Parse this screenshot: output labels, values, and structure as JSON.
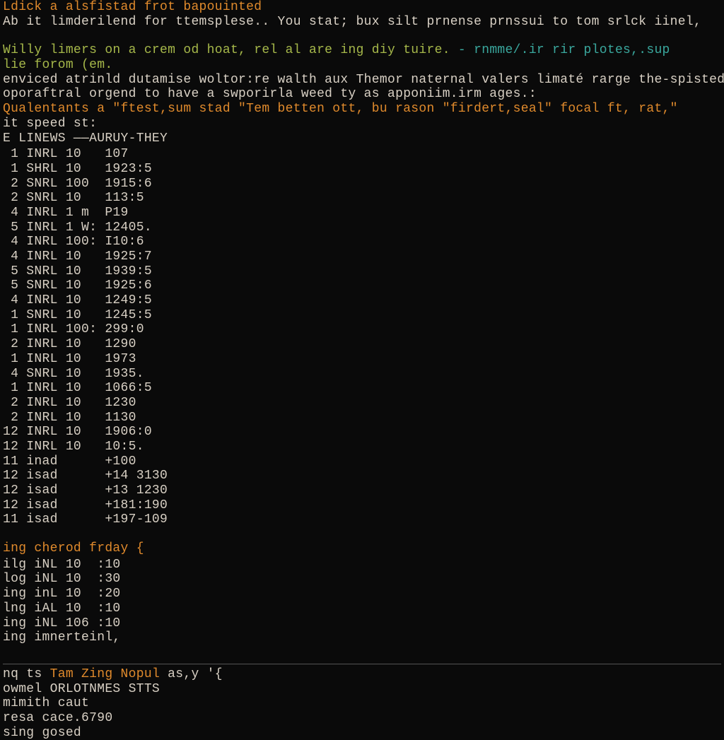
{
  "top": {
    "l1": "Ldick a alsfistad frot bapouinted",
    "l2": "Ab it limderilend for ttemsplese.. You stat; bux silt prnense prnssui to tom srlck iinel,",
    "l3_a": "Willy limers on a crem od hoat, rel al are ing diy tuire. ",
    "l3_b": "- rnmme/.ir rir plotes,.sup",
    "l4": "lie forom (em.",
    "l5": "enviced atrinld dutamise woltor:re walth aux Themor naternal valers limaté rarge the-spisted",
    "l6": "oporaftral orgend to have a swporirla weed ty as apponiim.irm ages.:",
    "l7": "Qualentants a \"ftest,sum stad \"Tem betten ott, bu rason \"firdert,seal\" focal ft, rat,\"",
    "l8": "it speed st:",
    "header": "E LINEWS ——AURUY-THEY"
  },
  "rows": [
    {
      "c1": " 1",
      "c2": "INRL",
      "c3": "10",
      "c4": "107"
    },
    {
      "c1": " 1",
      "c2": "SHRL",
      "c3": "10",
      "c4": "1923:5"
    },
    {
      "c1": " 2",
      "c2": "SNRL",
      "c3": "100",
      "c4": "1915:6"
    },
    {
      "c1": " 2",
      "c2": "SNRL",
      "c3": "10",
      "c4": "113:5"
    },
    {
      "c1": " 4",
      "c2": "INRL",
      "c3": "1 m",
      "c4": "P19"
    },
    {
      "c1": " 5",
      "c2": "INRL",
      "c3": "1 W:",
      "c4": "12405."
    },
    {
      "c1": " 4",
      "c2": "INRL",
      "c3": "100:",
      "c4": "I10:6"
    },
    {
      "c1": " 4",
      "c2": "INRL",
      "c3": "10",
      "c4": "1925:7"
    },
    {
      "c1": " 5",
      "c2": "SNRL",
      "c3": "10",
      "c4": "1939:5"
    },
    {
      "c1": " 5",
      "c2": "SNRL",
      "c3": "10",
      "c4": "1925:6"
    },
    {
      "c1": " 4",
      "c2": "INRL",
      "c3": "10",
      "c4": "1249:5"
    },
    {
      "c1": " 1",
      "c2": "SNRL",
      "c3": "10",
      "c4": "1245:5"
    },
    {
      "c1": " 1",
      "c2": "INRL",
      "c3": "100:",
      "c4": "299:0"
    },
    {
      "c1": " 2",
      "c2": "INRL",
      "c3": "10",
      "c4": "1290"
    },
    {
      "c1": " 1",
      "c2": "INRL",
      "c3": "10",
      "c4": "1973"
    },
    {
      "c1": " 4",
      "c2": "SNRL",
      "c3": "10",
      "c4": "1935."
    },
    {
      "c1": " 1",
      "c2": "INRL",
      "c3": "10",
      "c4": "1066:5"
    },
    {
      "c1": " 2",
      "c2": "INRL",
      "c3": "10",
      "c4": "1230"
    },
    {
      "c1": " 2",
      "c2": "INRL",
      "c3": "10",
      "c4": "1130"
    },
    {
      "c1": "12",
      "c2": "INRL",
      "c3": "10",
      "c4": "1906:0"
    },
    {
      "c1": "12",
      "c2": "INRL",
      "c3": "10",
      "c4": "10:5."
    },
    {
      "c1": "11",
      "c2": "inad",
      "c3": "",
      "c4": "+100"
    },
    {
      "c1": "12",
      "c2": "isad",
      "c3": "",
      "c4": "+14 3130"
    },
    {
      "c1": "12",
      "c2": "isad",
      "c3": "",
      "c4": "+13 1230"
    },
    {
      "c1": "12",
      "c2": "isad",
      "c3": "",
      "c4": "+181:190"
    },
    {
      "c1": "11",
      "c2": "isad",
      "c3": "",
      "c4": "+197-109"
    }
  ],
  "mid": {
    "heading": "ing cherod frday {",
    "logs": [
      {
        "a": "ilg",
        "b": "iNL",
        "c": "10",
        "d": ":10"
      },
      {
        "a": "log",
        "b": "iNL",
        "c": "10",
        "d": ":30"
      },
      {
        "a": "ing",
        "b": "inL",
        "c": "10",
        "d": ":20"
      },
      {
        "a": "lng",
        "b": "iAL",
        "c": "10",
        "d": ":10"
      },
      {
        "a": "ing",
        "b": "iNL",
        "c": "106",
        "d": ":10"
      }
    ],
    "tail": "ing imnerteinl,"
  },
  "bottom": {
    "l1_pre": "nq ts ",
    "l1_hl": "Tam Zing Nopul",
    "l1_post": " as,y '{",
    "l2": "owmel ORLOTNMES STTS",
    "l3": "mimith caut",
    "l4": "resa cace.6790",
    "l5": "sing gosed"
  }
}
